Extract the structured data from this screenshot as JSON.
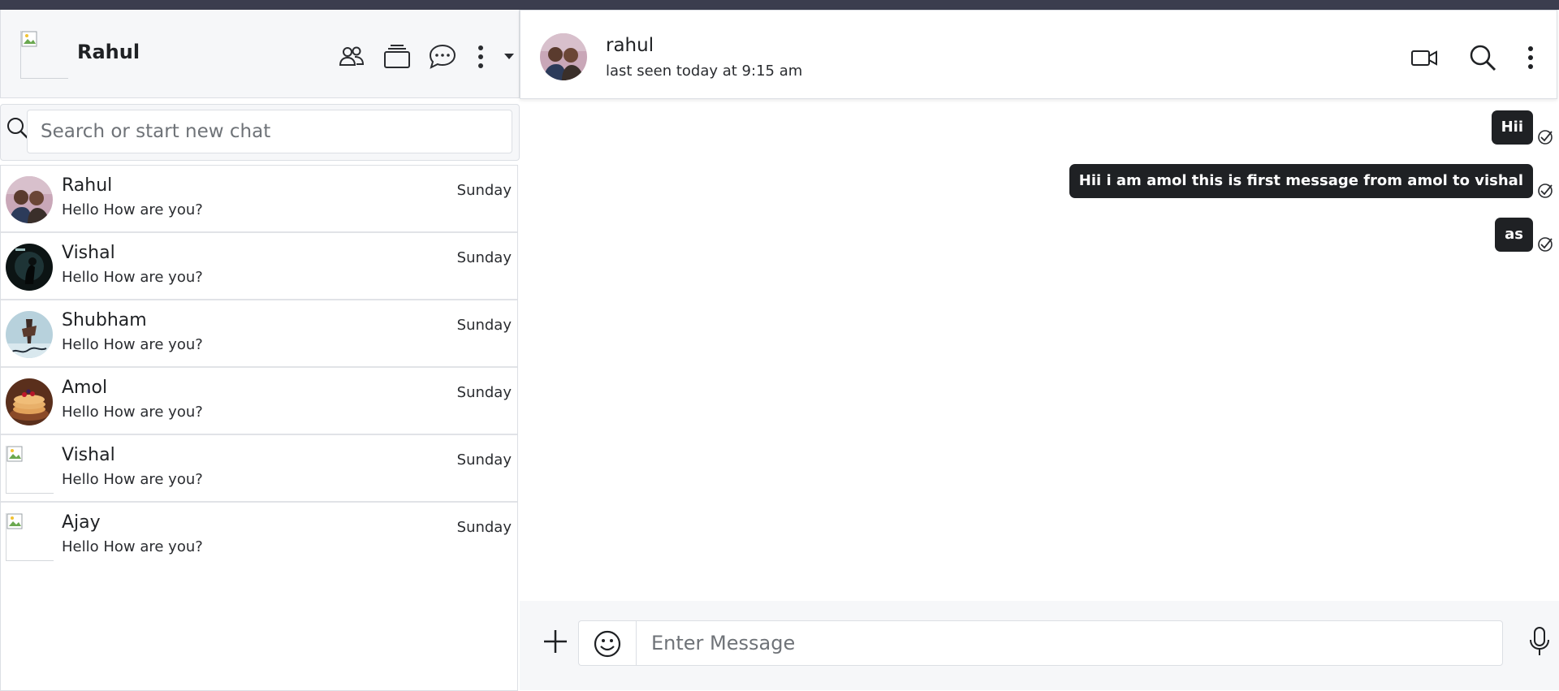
{
  "me": {
    "name": "Rahul"
  },
  "search": {
    "placeholder": "Search or start new chat"
  },
  "chats": [
    {
      "name": "Rahul",
      "last_message": "Hello How are you?",
      "time": "Sunday"
    },
    {
      "name": "Vishal",
      "last_message": "Hello How are you?",
      "time": "Sunday"
    },
    {
      "name": "Shubham",
      "last_message": "Hello How are you?",
      "time": "Sunday"
    },
    {
      "name": "Amol",
      "last_message": "Hello How are you?",
      "time": "Sunday"
    },
    {
      "name": "Vishal",
      "last_message": "Hello How are you?",
      "time": "Sunday"
    },
    {
      "name": "Ajay",
      "last_message": "Hello How are you?",
      "time": "Sunday"
    }
  ],
  "conversation": {
    "name": "rahul",
    "status": "last seen today at 9:15 am",
    "messages": [
      {
        "text": "Hii"
      },
      {
        "text": "Hii i am amol this is first message from amol to vishal"
      },
      {
        "text": "as"
      }
    ]
  },
  "composer": {
    "placeholder": "Enter Message"
  },
  "icons": {
    "header_left": [
      "people-icon",
      "stack-icon",
      "chat-bubble-icon",
      "more-vertical-icon",
      "caret-down-icon"
    ],
    "header_right": [
      "video-call-icon",
      "search-icon",
      "more-vertical-icon"
    ],
    "composer": [
      "plus-icon",
      "emoji-icon",
      "mic-icon"
    ],
    "message_status": "sent-check-icon"
  },
  "colors": {
    "bubble": "#1f2124",
    "topbar": "#3b3d4e",
    "panel_bg": "#f6f7f9"
  }
}
